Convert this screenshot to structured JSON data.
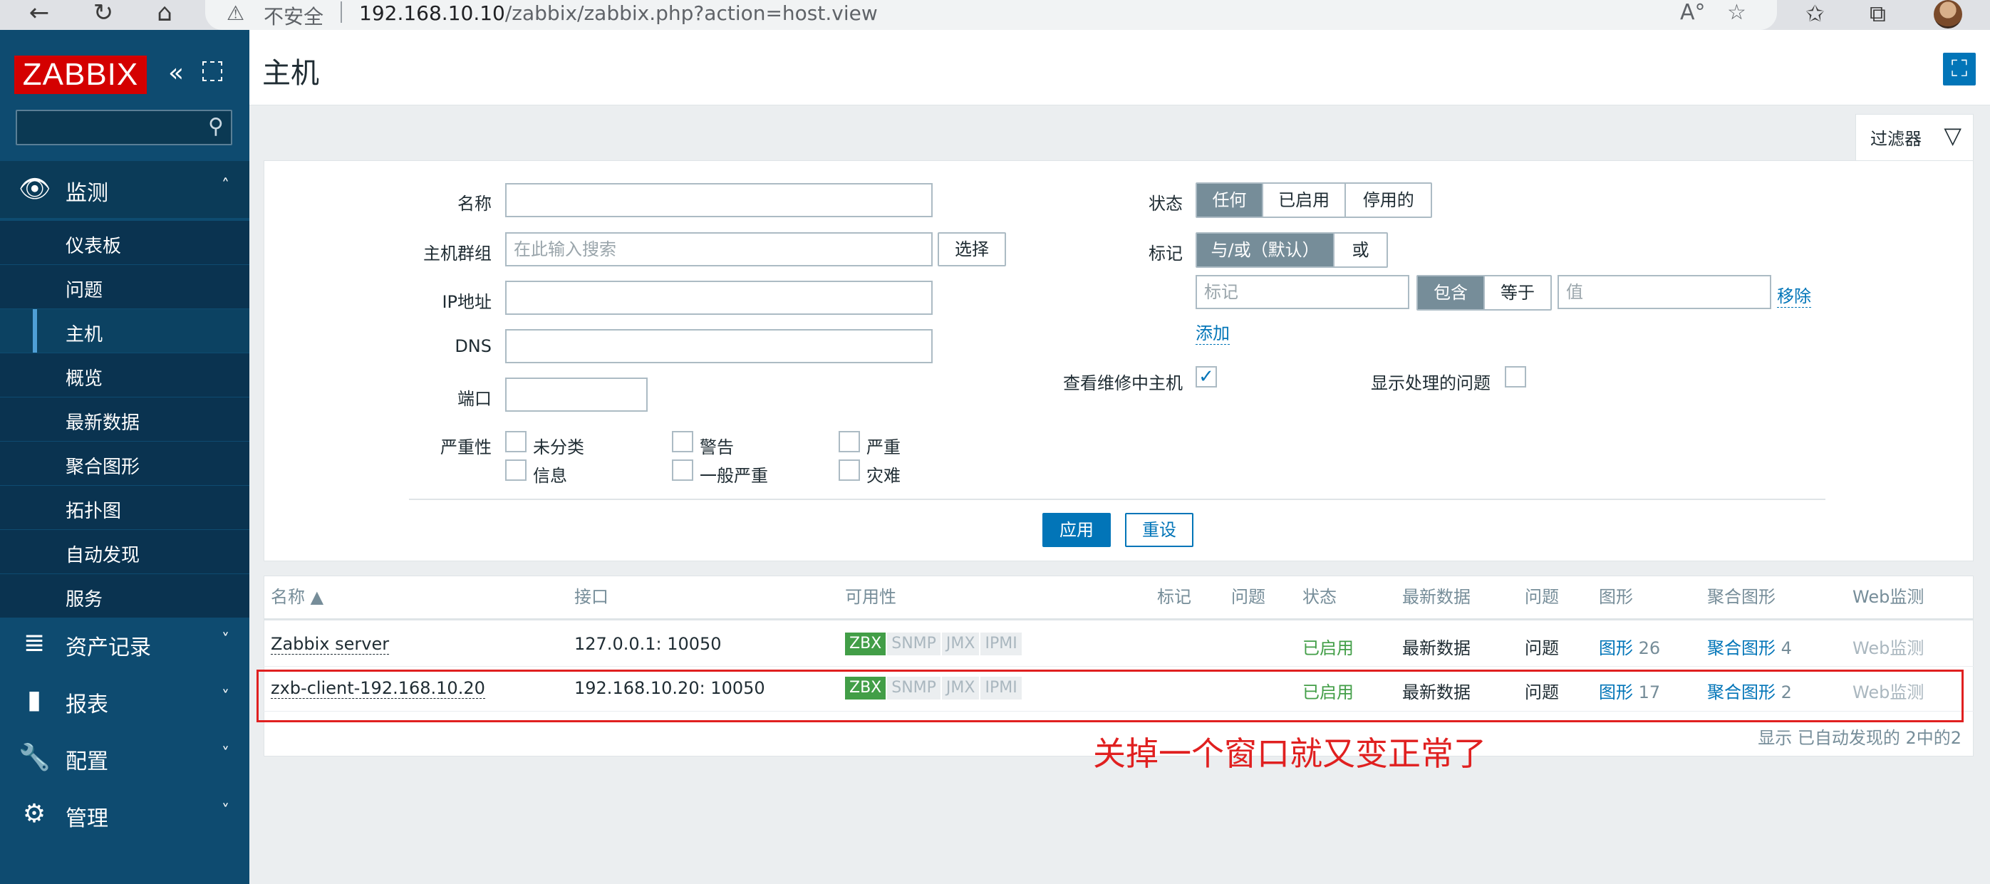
{
  "browser": {
    "back_icon": "←",
    "reload_icon": "↻",
    "home_icon": "⌂",
    "warning_icon": "⚠",
    "insecure_label": "不安全",
    "url_host": "192.168.10.10",
    "url_path": "/zabbix/zabbix.php?action=host.view",
    "read_aloud_icon": "A°",
    "add_favorite_icon": "☆",
    "favorites_icon": "✩",
    "collections_icon": "⧉"
  },
  "sidebar": {
    "logo": "ZABBIX",
    "collapse_icon": "«",
    "search_icon": "⚲",
    "sections": [
      {
        "icon": "👁",
        "label": "监测",
        "chevron": "˄"
      },
      {
        "icon": "≣",
        "label": "资产记录",
        "chevron": "˅"
      },
      {
        "icon": "▮",
        "label": "报表",
        "chevron": "˅"
      },
      {
        "icon": "🔧",
        "label": "配置",
        "chevron": "˅"
      },
      {
        "icon": "⚙",
        "label": "管理",
        "chevron": "˅"
      }
    ],
    "monitoring_items": [
      "仪表板",
      "问题",
      "主机",
      "概览",
      "最新数据",
      "聚合图形",
      "拓扑图",
      "自动发现",
      "服务"
    ],
    "active_item": "主机"
  },
  "header": {
    "title": "主机",
    "fullscreen_icon": "⛶"
  },
  "filter": {
    "tab_label": "过滤器",
    "funnel_icon": "▽",
    "name_label": "名称",
    "name_value": "",
    "hostgroup_label": "主机群组",
    "hostgroup_placeholder": "在此输入搜索",
    "select_button": "选择",
    "ip_label": "IP地址",
    "dns_label": "DNS",
    "port_label": "端口",
    "severity_label": "严重性",
    "severities": [
      "未分类",
      "警告",
      "严重",
      "信息",
      "一般严重",
      "灾难"
    ],
    "status_label": "状态",
    "status_options": [
      "任何",
      "已启用",
      "停用的"
    ],
    "status_selected": "任何",
    "tags_label": "标记",
    "tag_operator_options": [
      "与/或（默认）",
      "或"
    ],
    "tag_placeholder": "标记",
    "tag_match_options": [
      "包含",
      "等于"
    ],
    "value_placeholder": "值",
    "remove_link": "移除",
    "add_link": "添加",
    "maintenance_label": "查看维修中主机",
    "maintenance_checked": true,
    "suppressed_label": "显示处理的问题",
    "suppressed_checked": false,
    "apply_button": "应用",
    "reset_button": "重设"
  },
  "table": {
    "columns": [
      "名称 ▲",
      "接口",
      "可用性",
      "标记",
      "问题",
      "状态",
      "最新数据",
      "问题",
      "图形",
      "聚合图形",
      "Web监测"
    ],
    "rows": [
      {
        "name": "Zabbix server",
        "interface": "127.0.0.1: 10050",
        "availability": [
          "ZBX",
          "SNMP",
          "JMX",
          "IPMI"
        ],
        "status": "已启用",
        "latest": "最新数据",
        "problems": "问题",
        "graphs": "图形",
        "graphs_count": "26",
        "screens": "聚合图形",
        "screens_count": "4",
        "web": "Web监测"
      },
      {
        "name": "zxb-client-192.168.10.20",
        "interface": "192.168.10.20: 10050",
        "availability": [
          "ZBX",
          "SNMP",
          "JMX",
          "IPMI"
        ],
        "status": "已启用",
        "latest": "最新数据",
        "problems": "问题",
        "graphs": "图形",
        "graphs_count": "17",
        "screens": "聚合图形",
        "screens_count": "2",
        "web": "Web监测"
      }
    ],
    "footer": "显示 已自动发现的 2中的2"
  },
  "annotation": "关掉一个窗口就又变正常了",
  "colors": {
    "sidebar": "#0e4b70",
    "logo_red": "#d40000",
    "link_blue": "#0275b8",
    "status_green": "#429e47",
    "annotation_red": "#e02020"
  }
}
